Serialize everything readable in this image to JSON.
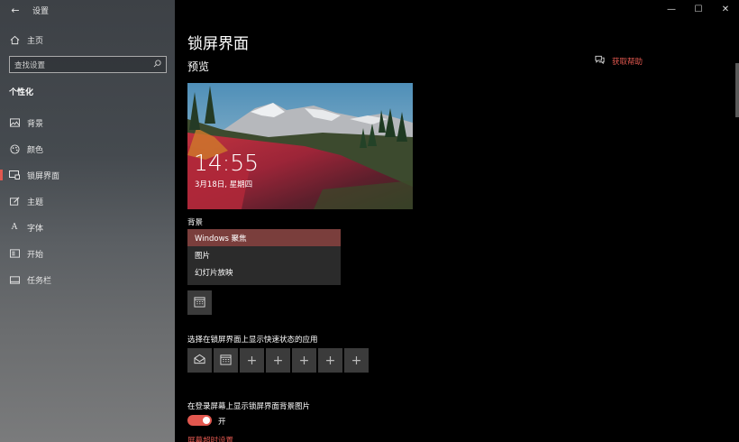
{
  "window": {
    "title": "设置",
    "minimize": "—",
    "maximize": "☐",
    "close": "✕"
  },
  "sidebar": {
    "home": "主页",
    "search_placeholder": "查找设置",
    "group_title": "个性化",
    "items": [
      {
        "label": "背景",
        "icon": "picture-icon"
      },
      {
        "label": "颜色",
        "icon": "palette-icon"
      },
      {
        "label": "锁屏界面",
        "icon": "lock-screen-icon",
        "active": true
      },
      {
        "label": "主题",
        "icon": "theme-brush-icon"
      },
      {
        "label": "字体",
        "icon": "font-icon"
      },
      {
        "label": "开始",
        "icon": "start-menu-icon"
      },
      {
        "label": "任务栏",
        "icon": "taskbar-icon"
      }
    ]
  },
  "main": {
    "page_title": "锁屏界面",
    "preview_label": "预览",
    "help_link": "获取帮助",
    "preview": {
      "time": "14:55",
      "date": "3月18日, 星期四"
    },
    "background_label": "背景",
    "background_options": [
      "Windows 聚焦",
      "图片",
      "幻灯片放映"
    ],
    "background_selected": "Windows 聚焦",
    "quick_status_label": "选择在锁屏界面上显示快速状态的应用",
    "signin_label": "在登录屏幕上显示锁屏界面背景图片",
    "toggle_state": "开",
    "toggle_on": true,
    "bottom_link": "屏幕超时设置"
  },
  "colors": {
    "accent": "#e2584f",
    "selected_option": "#7a3e3c",
    "tile": "#3b3b3b"
  }
}
